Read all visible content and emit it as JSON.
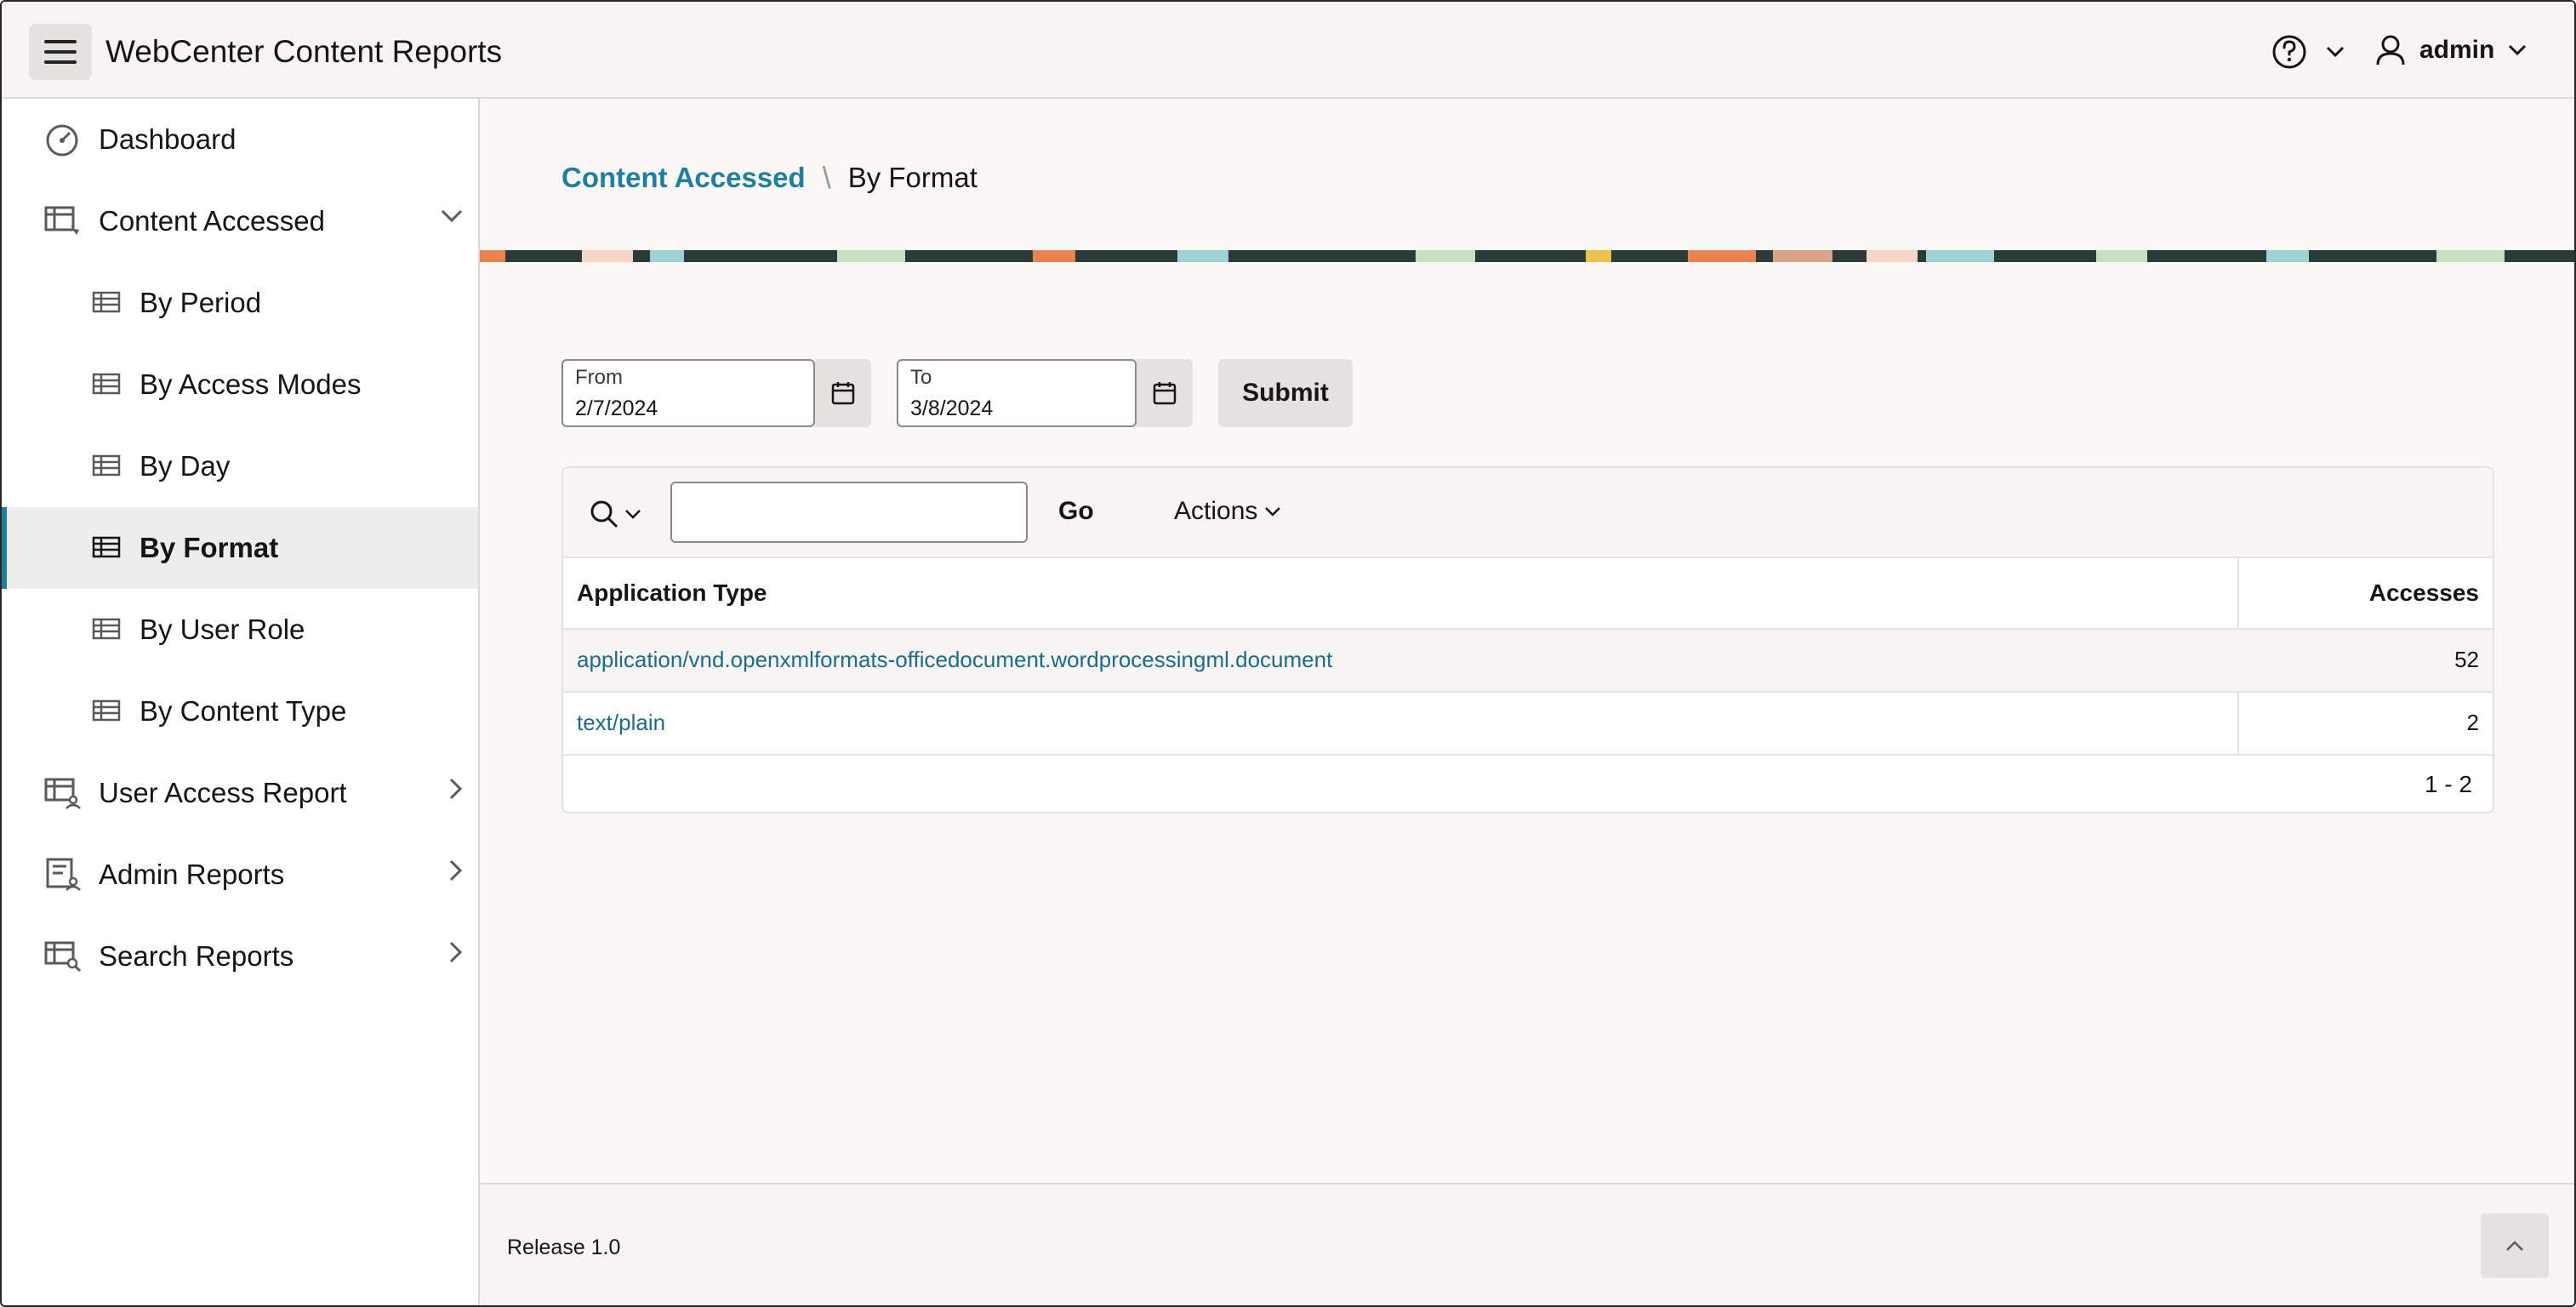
{
  "header": {
    "app_title": "WebCenter Content Reports",
    "user_name": "admin"
  },
  "sidebar": {
    "items": [
      {
        "label": "Dashboard",
        "icon": "dashboard-icon"
      },
      {
        "label": "Content Accessed",
        "icon": "report-icon",
        "expanded": true
      },
      {
        "label": "By Period",
        "icon": "table-icon"
      },
      {
        "label": "By Access Modes",
        "icon": "table-icon"
      },
      {
        "label": "By Day",
        "icon": "table-icon"
      },
      {
        "label": "By Format",
        "icon": "table-icon",
        "active": true
      },
      {
        "label": "By User Role",
        "icon": "table-icon"
      },
      {
        "label": "By Content Type",
        "icon": "table-icon"
      },
      {
        "label": "User Access Report",
        "icon": "user-report-icon"
      },
      {
        "label": "Admin Reports",
        "icon": "admin-report-icon"
      },
      {
        "label": "Search Reports",
        "icon": "search-report-icon"
      }
    ]
  },
  "breadcrumb": {
    "parent": "Content Accessed",
    "separator": "\\",
    "current": "By Format"
  },
  "filters": {
    "from_label": "From",
    "from_value": "2/7/2024",
    "to_label": "To",
    "to_value": "3/8/2024",
    "submit_label": "Submit"
  },
  "report": {
    "search_placeholder": "",
    "go_label": "Go",
    "actions_label": "Actions",
    "columns": [
      "Application Type",
      "Accesses"
    ],
    "rows": [
      {
        "type": "application/vnd.openxmlformats-officedocument.wordprocessingml.document",
        "accesses": "52"
      },
      {
        "type": "text/plain",
        "accesses": "2"
      }
    ],
    "pagination": "1 - 2"
  },
  "footer": {
    "release": "Release 1.0"
  },
  "colors": {
    "accent": "#227e9e",
    "link": "#1f6a8a"
  }
}
